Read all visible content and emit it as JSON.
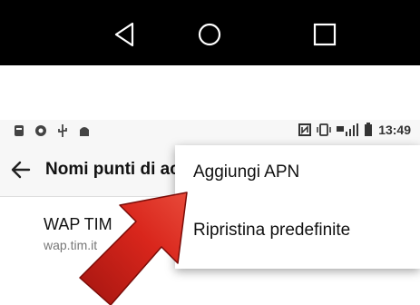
{
  "status_bar": {
    "time": "13:49"
  },
  "app_bar": {
    "title": "Nomi punti di accesso"
  },
  "list": {
    "items": [
      {
        "title": "WAP TIM",
        "subtitle": "wap.tim.it"
      }
    ]
  },
  "popup_menu": {
    "items": [
      {
        "label": "Aggiungi APN"
      },
      {
        "label": "Ripristina predefinite"
      }
    ]
  },
  "colors": {
    "arrow": "#d9261c",
    "navbar": "#000000"
  }
}
